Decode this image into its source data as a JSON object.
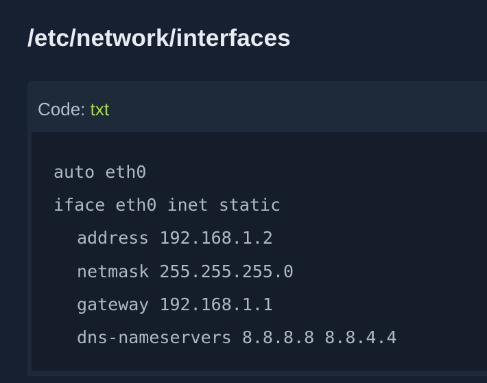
{
  "page": {
    "heading": "/etc/network/interfaces"
  },
  "code_block": {
    "label_prefix": "Code: ",
    "language": "txt",
    "lines": [
      "auto eth0",
      "iface eth0 inet static",
      "address 192.168.1.2",
      "netmask 255.255.255.0",
      "gateway 192.168.1.1",
      "dns-nameservers 8.8.8.8 8.8.4.4"
    ]
  },
  "colors": {
    "background": "#172030",
    "code_header": "#1e2939",
    "code_body": "#151d2a",
    "heading_text": "#e9edf3",
    "code_text": "#aeb8c7",
    "language_accent": "#a6e22e"
  }
}
